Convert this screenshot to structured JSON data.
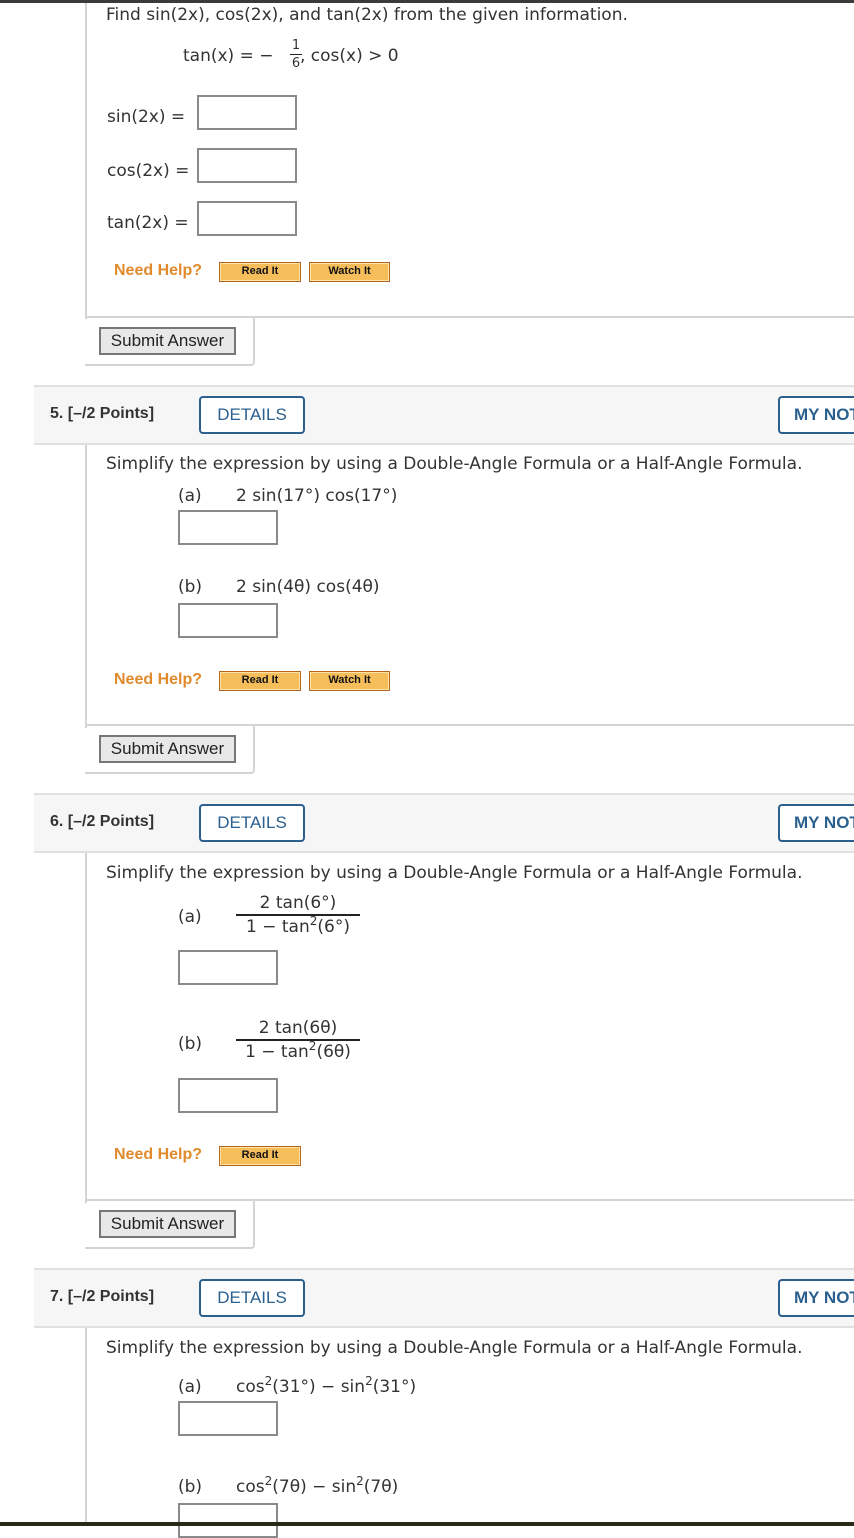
{
  "q4": {
    "prompt": "Find sin(2x), cos(2x), and tan(2x) from the given information.",
    "given_lhs": "tan(x) = −",
    "given_frac_num": "1",
    "given_frac_den": "6",
    "given_rhs": ",   cos(x) > 0",
    "fields": [
      {
        "label": "sin(2x) =",
        "value": ""
      },
      {
        "label": "cos(2x) =",
        "value": ""
      },
      {
        "label": "tan(2x) =",
        "value": ""
      }
    ],
    "need_help": "Need Help?",
    "read_it": "Read It",
    "watch_it": "Watch It",
    "submit": "Submit Answer"
  },
  "q5": {
    "number": "5.  [–/2 Points]",
    "details": "DETAILS",
    "notes": "MY NOTES",
    "prompt": "Simplify the expression by using a Double-Angle Formula or a Half-Angle Formula.",
    "parts": [
      {
        "label": "(a)",
        "expr": "2 sin(17°) cos(17°)",
        "value": ""
      },
      {
        "label": "(b)",
        "expr": "2 sin(4θ) cos(4θ)",
        "value": ""
      }
    ],
    "need_help": "Need Help?",
    "read_it": "Read It",
    "watch_it": "Watch It",
    "submit": "Submit Answer"
  },
  "q6": {
    "number": "6.  [–/2 Points]",
    "details": "DETAILS",
    "notes": "MY NOTES",
    "prompt": "Simplify the expression by using a Double-Angle Formula or a Half-Angle Formula.",
    "parts": [
      {
        "label": "(a)",
        "num": "2 tan(6°)",
        "den_pre": "1 − tan",
        "den_exp": "2",
        "den_post": "(6°)",
        "value": ""
      },
      {
        "label": "(b)",
        "num": "2 tan(6θ)",
        "den_pre": "1 − tan",
        "den_exp": "2",
        "den_post": "(6θ)",
        "value": ""
      }
    ],
    "need_help": "Need Help?",
    "read_it": "Read It",
    "submit": "Submit Answer"
  },
  "q7": {
    "number": "7.  [–/2 Points]",
    "details": "DETAILS",
    "notes": "MY NOTES",
    "prompt": "Simplify the expression by using a Double-Angle Formula or a Half-Angle Formula.",
    "parts": [
      {
        "label": "(a)",
        "t1": "cos",
        "e1": "2",
        "a1": "(31°) − sin",
        "e2": "2",
        "a2": "(31°)",
        "value": ""
      },
      {
        "label": "(b)",
        "t1": "cos",
        "e1": "2",
        "a1": "(7θ) − sin",
        "e2": "2",
        "a2": "(7θ)",
        "value": ""
      }
    ]
  }
}
